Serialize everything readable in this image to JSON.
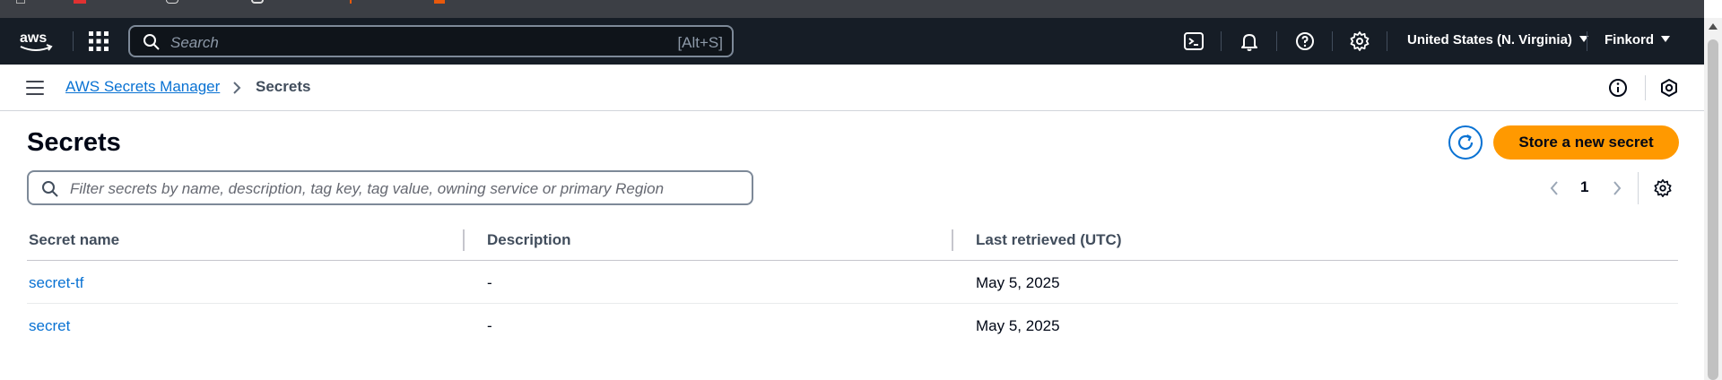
{
  "topnav": {
    "logo_icon": "aws-logo",
    "search": {
      "placeholder": "Search",
      "shortcut": "[Alt+S]"
    },
    "icons": [
      "cloudshell-icon",
      "bell-icon",
      "help-icon",
      "gear-icon"
    ],
    "region": "United States (N. Virginia)",
    "account": "Finkord"
  },
  "subheader": {
    "breadcrumb": {
      "service": "AWS Secrets Manager",
      "current": "Secrets"
    }
  },
  "main": {
    "title": "Secrets",
    "store_button": "Store a new secret",
    "filter": {
      "placeholder": "Filter secrets by name, description, tag key, tag value, owning service or primary Region"
    },
    "pagination": {
      "current_page": "1"
    },
    "table": {
      "columns": [
        "Secret name",
        "Description",
        "Last retrieved (UTC)"
      ],
      "rows": [
        {
          "name": "secret-tf",
          "description": "-",
          "last_retrieved": "May 5, 2025"
        },
        {
          "name": "secret",
          "description": "-",
          "last_retrieved": "May 5, 2025"
        }
      ]
    }
  },
  "colors": {
    "nav_bg": "#161d26",
    "link": "#0972d3",
    "primary": "#ff9900"
  }
}
